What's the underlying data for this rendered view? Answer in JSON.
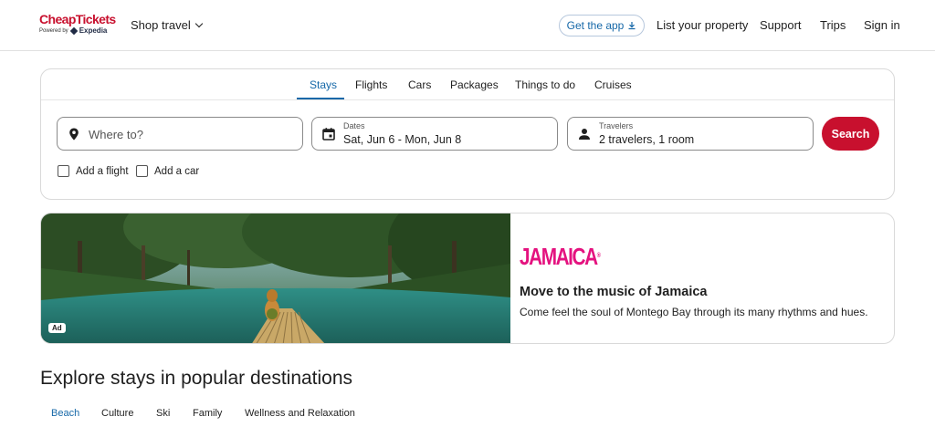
{
  "header": {
    "logo_text": "CheapTickets",
    "logo_sub_prefix": "Powered by",
    "logo_sub_brand": "Expedia",
    "shop_travel": "Shop travel",
    "get_app": "Get the app",
    "list_property": "List your property",
    "support": "Support",
    "trips": "Trips",
    "sign_in": "Sign in"
  },
  "search": {
    "tabs": [
      {
        "label": "Stays",
        "active": true
      },
      {
        "label": "Flights",
        "active": false
      },
      {
        "label": "Cars",
        "active": false
      },
      {
        "label": "Packages",
        "active": false
      },
      {
        "label": "Things to do",
        "active": false
      },
      {
        "label": "Cruises",
        "active": false
      }
    ],
    "destination_placeholder": "Where to?",
    "dates_label": "Dates",
    "dates_value": "Sat, Jun 6 - Mon, Jun 8",
    "travelers_label": "Travelers",
    "travelers_value": "2 travelers, 1 room",
    "search_button": "Search",
    "add_flight": "Add a flight",
    "add_car": "Add a car"
  },
  "ad": {
    "badge": "Ad",
    "brand": "JAMAICA",
    "brand_mark": "®",
    "title": "Move to the music of Jamaica",
    "description": "Come feel the soul of Montego Bay through its many rhythms and hues."
  },
  "explore": {
    "title": "Explore stays in popular destinations",
    "tabs": [
      {
        "label": "Beach",
        "active": true
      },
      {
        "label": "Culture",
        "active": false
      },
      {
        "label": "Ski",
        "active": false
      },
      {
        "label": "Family",
        "active": false
      },
      {
        "label": "Wellness and Relaxation",
        "active": false
      }
    ]
  },
  "colors": {
    "brand_red": "#c8102e",
    "link_blue": "#1668a8",
    "jamaica_pink": "#e4127f"
  }
}
